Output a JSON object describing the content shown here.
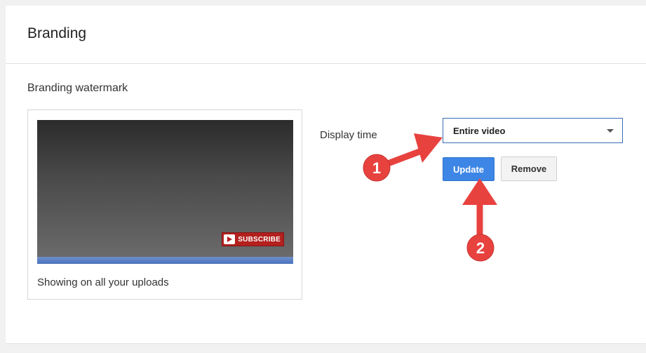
{
  "header": {
    "title": "Branding"
  },
  "watermark": {
    "section_title": "Branding watermark",
    "badge_text": "SUBSCRIBE",
    "caption": "Showing on all your uploads"
  },
  "display_time": {
    "label": "Display time",
    "selected": "Entire video"
  },
  "actions": {
    "update_label": "Update",
    "remove_label": "Remove"
  },
  "annotations": {
    "step1": "1",
    "step2": "2"
  },
  "colors": {
    "primary_button": "#3d86e6",
    "annotation_red": "#e8423f",
    "select_border": "#3b6fb6"
  }
}
